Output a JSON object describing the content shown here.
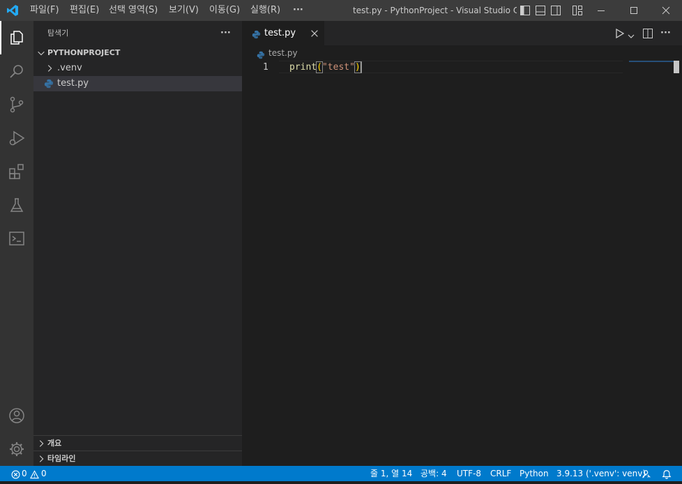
{
  "titlebar": {
    "menus": [
      "파일(F)",
      "편집(E)",
      "선택 영역(S)",
      "보기(V)",
      "이동(G)",
      "실행(R)"
    ],
    "more": "···",
    "window_title": "test.py - PythonProject - Visual Studio Code"
  },
  "sidebar": {
    "title": "탐색기",
    "more": "···",
    "project": "PYTHONPROJECT",
    "items": [
      {
        "label": ".venv",
        "type": "folder"
      },
      {
        "label": "test.py",
        "type": "python-file"
      }
    ],
    "panels": [
      "개요",
      "타임라인"
    ]
  },
  "editor": {
    "tab_label": "test.py",
    "breadcrumb": "test.py",
    "more": "···",
    "lines": [
      {
        "number": "1",
        "tokens": [
          "print",
          "(",
          "\"test\"",
          ")"
        ]
      }
    ],
    "colors": {
      "function": "#dcdcaa",
      "paren": "#ffd700",
      "string": "#ce9178",
      "accent": "#007acc"
    }
  },
  "statusbar": {
    "errors": "0",
    "warnings": "0",
    "position": "줄 1, 열 14",
    "spaces": "공백: 4",
    "encoding": "UTF-8",
    "eol": "CRLF",
    "language": "Python",
    "interpreter": "3.9.13 ('.venv': venv)"
  }
}
